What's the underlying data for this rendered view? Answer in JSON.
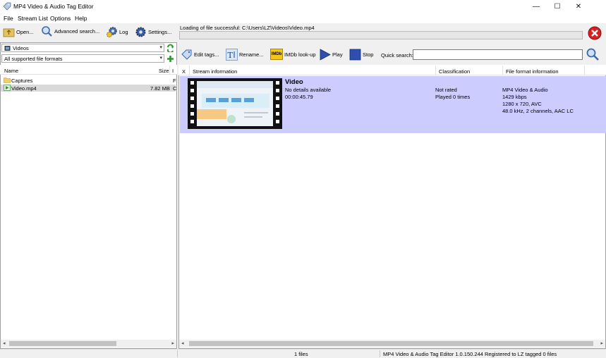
{
  "window": {
    "title": "MP4 Video & Audio Tag Editor",
    "controls": {
      "minimize": "—",
      "maximize": "☐",
      "close": "✕"
    }
  },
  "menu": [
    "File",
    "Stream List",
    "Options",
    "Help"
  ],
  "toolbar": {
    "open": "Open...",
    "advanced_search": "Advanced search...",
    "log": "Log",
    "settings": "Settings..."
  },
  "status_message": "Loading of file successful: C:\\Users\\LZ\\Videos\\Video.mp4",
  "left_panel": {
    "folder_combo": "Videos",
    "format_combo": "All supported file formats",
    "columns": {
      "name": "Name",
      "size": "Size",
      "extra": "I"
    },
    "rows": [
      {
        "name": "Captures",
        "size": "",
        "extra": "F",
        "icon": "folder-icon"
      },
      {
        "name": "Video.mp4",
        "size": "7.82 MB",
        "extra": "C",
        "icon": "video-file-icon"
      }
    ]
  },
  "right_toolbar": {
    "edit_tags": "Edit tags...",
    "rename": "Rename...",
    "imdb_badge": "IMDb",
    "imdb_lookup": "IMDb look-up",
    "play": "Play",
    "stop": "Stop",
    "quick_search_label": "Quick search:",
    "quick_search_value": ""
  },
  "stream_list": {
    "columns": {
      "x": "X",
      "stream": "Stream information",
      "classification": "Classification",
      "format": "File format information"
    },
    "item": {
      "title": "Video",
      "details": "No details available",
      "duration": "00:00:45.79",
      "rating": "Not rated",
      "played": "Played 0 times",
      "format": "MP4 Video & Audio",
      "bitrate": "1429 kbps",
      "resolution": "1280 x 720, AVC",
      "audio": "48.0 kHz, 2 channels, AAC LC"
    }
  },
  "statusbar": {
    "files": "1 files",
    "info": "MP4 Video & Audio Tag Editor 1.0.150.244 Registered to LZ tagged 0 files"
  },
  "colors": {
    "selection": "#ccccff",
    "accent_blue": "#2a6fd6",
    "close_red": "#d62020"
  }
}
